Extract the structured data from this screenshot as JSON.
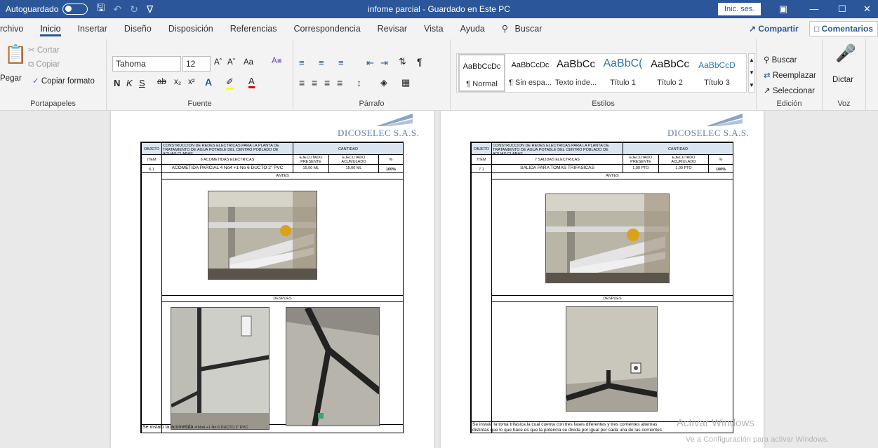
{
  "titlebar": {
    "autosave_label": "Autoguardado",
    "doc_title": "infome parcial - Guardado en Este PC",
    "signin": "Inic. ses.",
    "minimize": "—",
    "maximize": "☐",
    "close": "✕"
  },
  "tabs": [
    "rchivo",
    "Inicio",
    "Insertar",
    "Diseño",
    "Disposición",
    "Referencias",
    "Correspondencia",
    "Revisar",
    "Vista",
    "Ayuda"
  ],
  "search_label": "Buscar",
  "share_label": "Compartir",
  "comments_label": "Comentarios",
  "clipboard": {
    "paste": "Pegar",
    "cut": "Cortar",
    "copy": "Copiar",
    "format_painter": "Copiar formato",
    "group": "Portapapeles"
  },
  "font": {
    "family": "Tahoma",
    "size": "12",
    "case": "Aa",
    "group": "Fuente"
  },
  "paragraph": {
    "group": "Párrafo"
  },
  "styles": {
    "items": [
      {
        "sample": "AaBbCcDc",
        "name": "¶ Normal"
      },
      {
        "sample": "AaBbCcDc",
        "name": "¶ Sin espa..."
      },
      {
        "sample": "AaBbCc",
        "name": "Texto inde..."
      },
      {
        "sample": "AaBbC(",
        "name": "Título 1"
      },
      {
        "sample": "AaBbCc",
        "name": "Título 2"
      },
      {
        "sample": "AaBbCcD",
        "name": "Título 3"
      }
    ],
    "group": "Estilos"
  },
  "editing": {
    "find": "Buscar",
    "replace": "Reemplazar",
    "select": "Seleccionar",
    "group": "Edición"
  },
  "voice": {
    "dictate": "Dictar",
    "group": "Voz"
  },
  "pages": [
    {
      "company": "DICOSELEC S.A.S.",
      "objeto_label": "OBJETO",
      "objeto_text": "CONSTRUCCION DE REDES ELECTRICAS PARA LA PLANTA DE TRATAMIENTO DE AGUA POTABLE DEL CENTRO POBLADO DE AGUAS CLARAS",
      "cantidad_label": "CANTIDAD",
      "item_label": "ITEM",
      "section_title": "6 ACOMETIDAS ELECTRICAS",
      "col_periodo": "EJECUTADO PRESENTE PERIODO",
      "col_acumulado": "EJECUTADO ACUMULADO",
      "col_pct": "%",
      "item_no": "6.1",
      "item_desc": "ACOMETIDA PARCIAL 4 No4 +1 No 6 DUCTO 2\" PVC",
      "periodo": "15,00 ML",
      "acumulado": "15,00 ML",
      "pct": "100%",
      "antes": "ANTES",
      "despues": "DESPUES",
      "caption_main": "Se instalo la acometida",
      "caption_small": "4 No4 +1 No 6 DUCTO 2\" PVC"
    },
    {
      "company": "DICOSELEC S.A.S.",
      "objeto_label": "OBJETO",
      "objeto_text": "CONSTRUCCION DE REDES ELECTRICAS PARA LA PLANTA DE TRATAMIENTO DE AGUA POTABLE DEL CENTRO POBLADO DE AGUAS CLARAS",
      "cantidad_label": "CANTIDAD",
      "item_label": "ITEM",
      "section_title": "7 SALIDAS ELECTRICAS",
      "col_periodo": "EJECUTADO PRESENTE PERIODO",
      "col_acumulado": "EJECUTADO ACUMULADO",
      "col_pct": "%",
      "item_no": "7.1",
      "item_desc": "SALIDA PARA TOMAS TRIFASICAS",
      "periodo": "1,00 PTO",
      "acumulado": "1,00 PTO",
      "pct": "100%",
      "antes": "ANTES",
      "despues": "DESPUES",
      "caption_line1": "Se instala la toma trifasica la cual cuenta con tres fases diferentes y tres corrientes alternas",
      "caption_line2": "distintas que lo que hace es que la potencia se divida por igual por cada una de las corrientes."
    }
  ],
  "watermark": {
    "line1": "Activar Windows",
    "line2": "Ve a Configuración para activar Windows."
  }
}
